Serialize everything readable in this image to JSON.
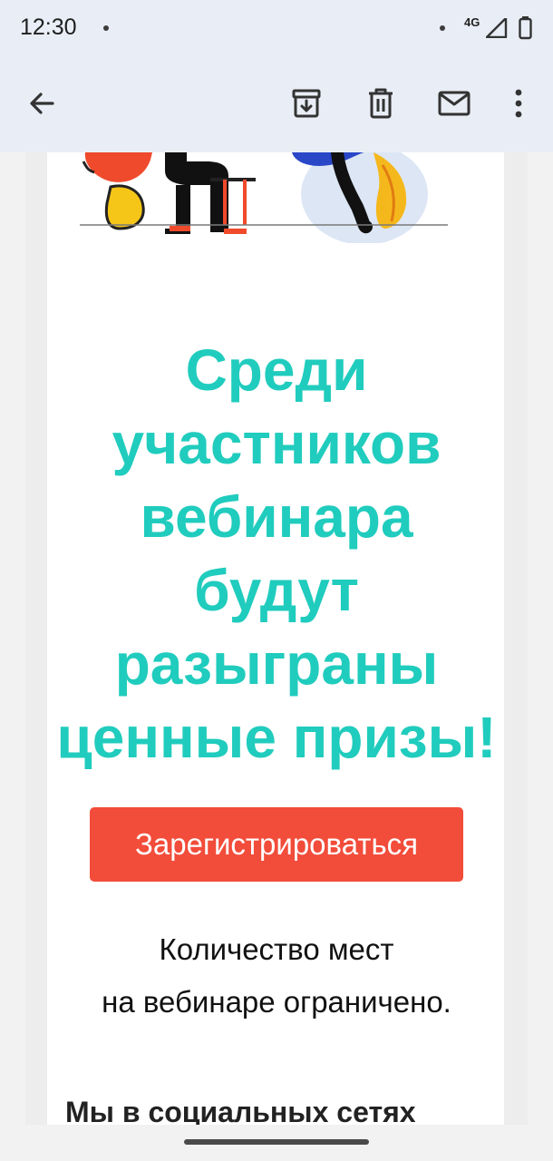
{
  "status_bar": {
    "time": "12:30",
    "network": "4G"
  },
  "toolbar": {
    "back_icon": "arrow-left-icon",
    "archive_icon": "archive-icon",
    "delete_icon": "trash-icon",
    "mark_unread_icon": "mail-icon",
    "more_icon": "more-vertical-icon"
  },
  "email": {
    "headline_lines": [
      "Среди",
      "участников",
      "вебинара",
      "будут",
      "разыграны",
      "ценные призы!"
    ],
    "cta_label": "Зарегистрироваться",
    "note_lines": [
      "Количество мест",
      "на вебинаре ограничено."
    ],
    "social_heading": "Мы в социальных сетях"
  },
  "colors": {
    "headline": "#20ccbd",
    "cta_background": "#f24c3a",
    "app_bar": "#e9eef6"
  }
}
